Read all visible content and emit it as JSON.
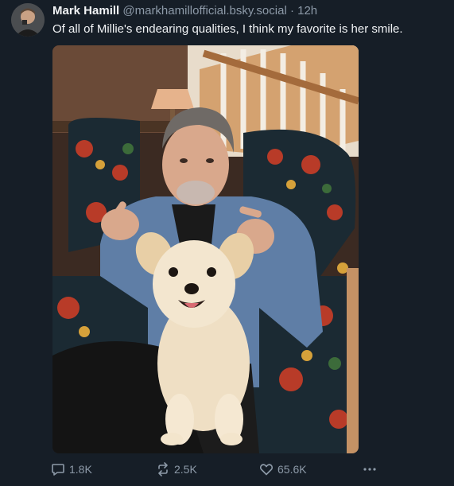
{
  "author": {
    "display_name": "Mark Hamill",
    "handle": "@markhamillofficial.bsky.social",
    "separator": "·",
    "time": "12h"
  },
  "post": {
    "text": "Of all of Millie's endearing qualities, I think my favorite is her smile."
  },
  "actions": {
    "replies": "1.8K",
    "reposts": "2.5K",
    "likes": "65.6K",
    "more_icon": "ellipsis-icon"
  },
  "colors": {
    "background": "#161e27",
    "text": "#f1f3f5",
    "muted": "#8d9aa8"
  }
}
